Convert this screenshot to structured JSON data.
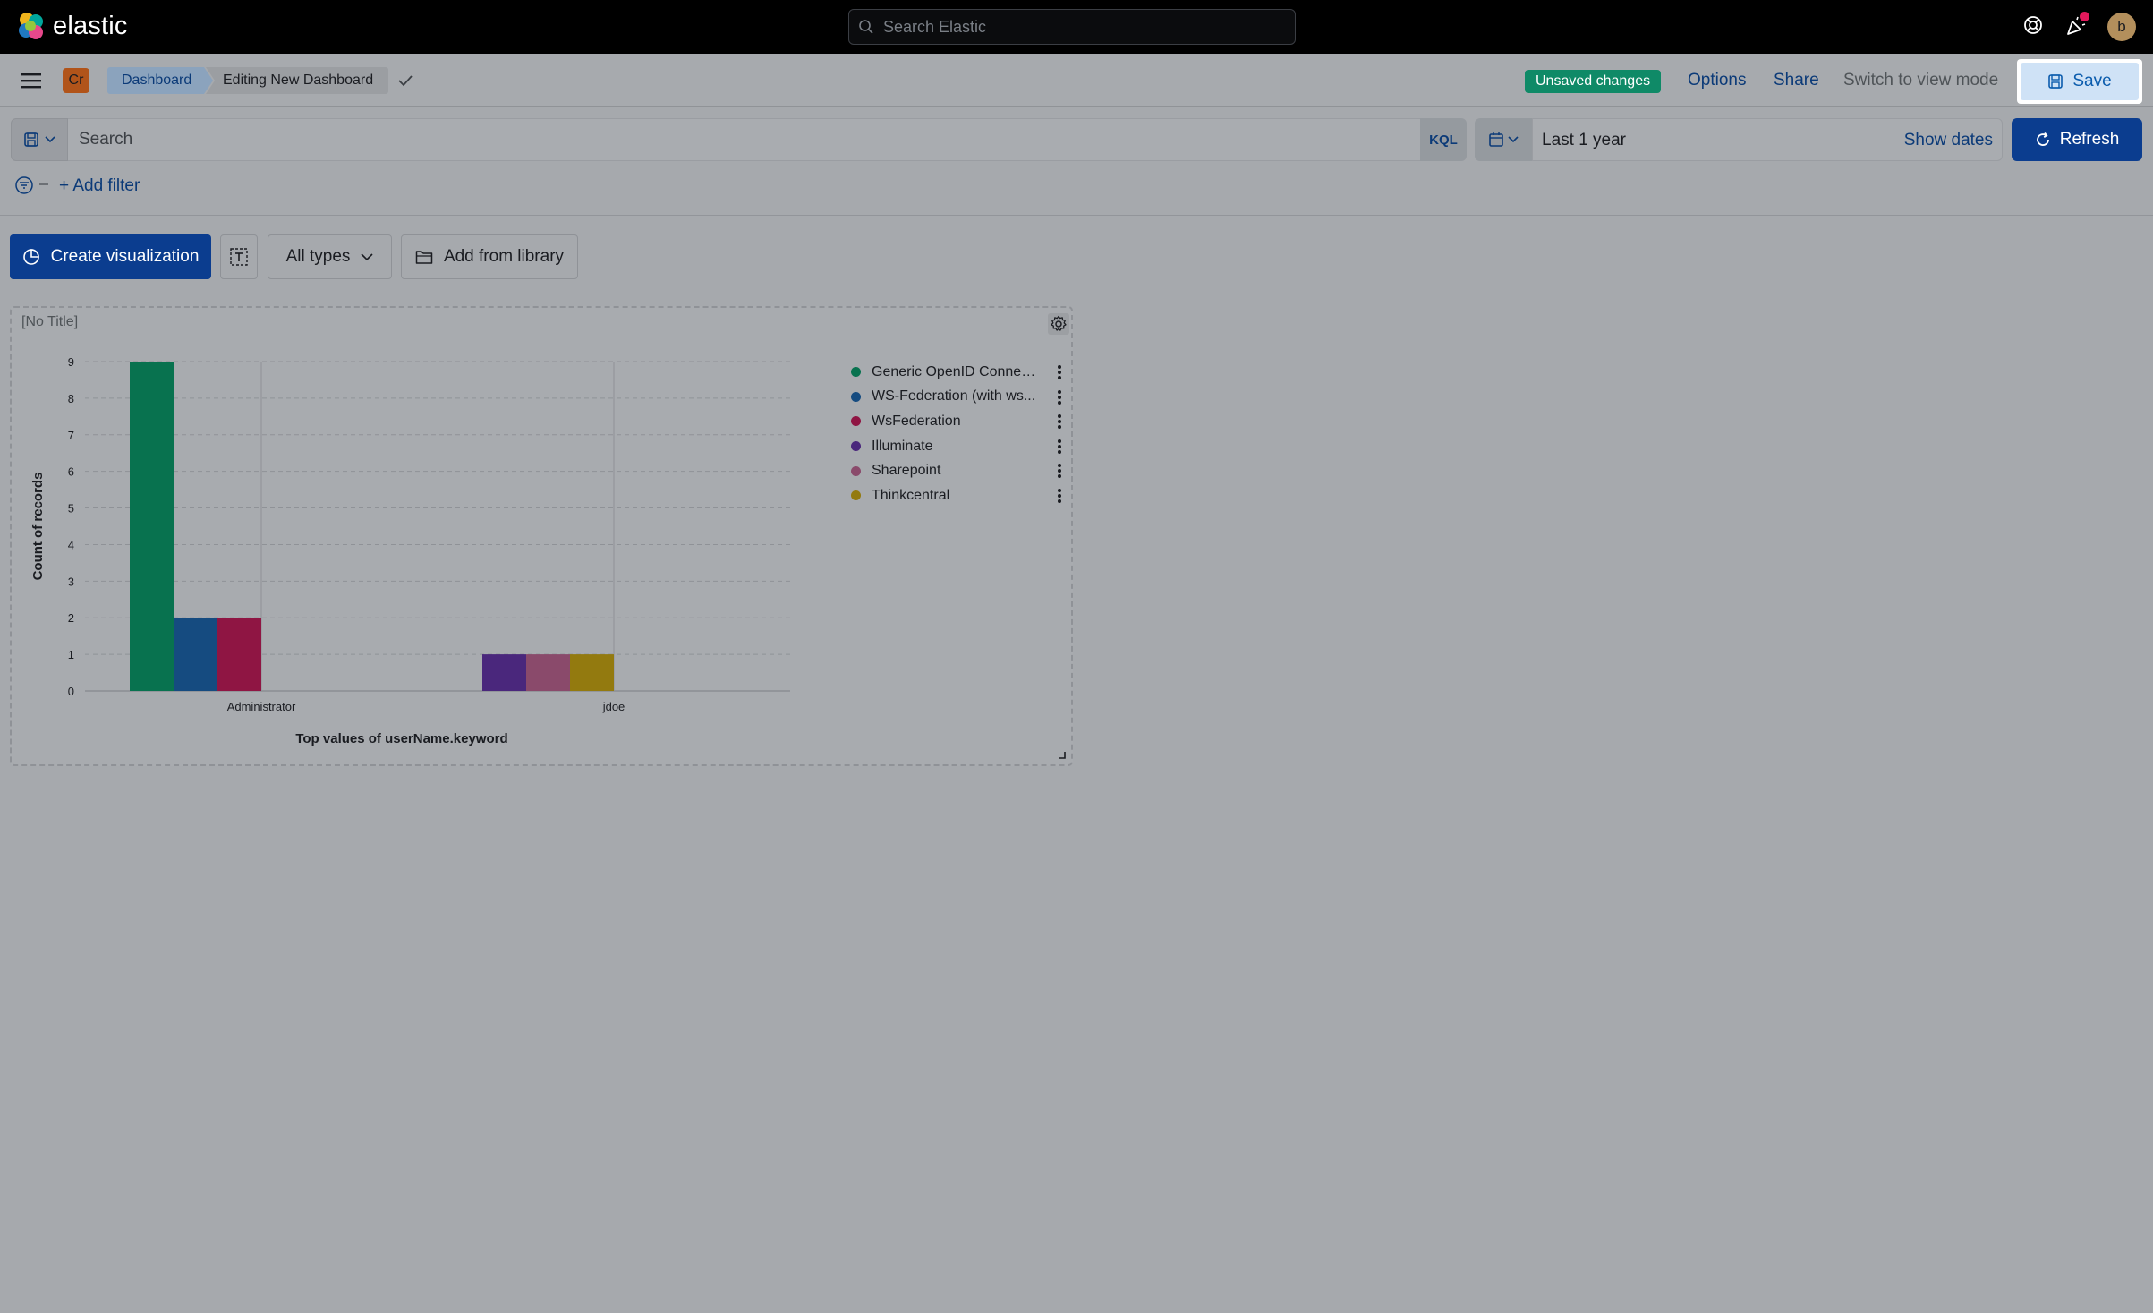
{
  "app": {
    "brand": "elastic",
    "global_search_placeholder": "Search Elastic"
  },
  "header": {
    "space_initials": "Cr",
    "breadcrumbs": [
      "Dashboard",
      "Editing New Dashboard"
    ],
    "unsaved_badge": "Unsaved changes",
    "options_label": "Options",
    "share_label": "Share",
    "view_mode_label": "Switch to view mode",
    "save_label": "Save",
    "user_initial": "b"
  },
  "query": {
    "placeholder": "Search",
    "language": "KQL",
    "date_range": "Last 1 year",
    "show_dates_label": "Show dates",
    "refresh_label": "Refresh",
    "add_filter_label": "+ Add filter"
  },
  "toolbar": {
    "create_viz_label": "Create visualization",
    "all_types_label": "All types",
    "add_library_label": "Add from library"
  },
  "panel": {
    "title": "[No Title]"
  },
  "chart_data": {
    "type": "bar",
    "title": "",
    "xlabel": "Top values of userName.keyword",
    "ylabel": "Count of records",
    "categories": [
      "Administrator",
      "jdoe"
    ],
    "ylim": [
      0,
      9
    ],
    "yticks": [
      0,
      1,
      2,
      3,
      4,
      5,
      6,
      7,
      8,
      9
    ],
    "grid": true,
    "legend_position": "right",
    "series": [
      {
        "name": "Generic OpenID Connec...",
        "color": "#08724f",
        "values": [
          9,
          0
        ]
      },
      {
        "name": "WS-Federation (with ws...",
        "color": "#154b80",
        "values": [
          2,
          0
        ]
      },
      {
        "name": "WsFederation",
        "color": "#8f1543",
        "values": [
          2,
          0
        ]
      },
      {
        "name": "Illuminate",
        "color": "#4a277c",
        "values": [
          0,
          1
        ]
      },
      {
        "name": "Sharepoint",
        "color": "#8a4a6b",
        "values": [
          0,
          1
        ]
      },
      {
        "name": "Thinkcentral",
        "color": "#937a0f",
        "values": [
          0,
          1
        ]
      }
    ]
  }
}
